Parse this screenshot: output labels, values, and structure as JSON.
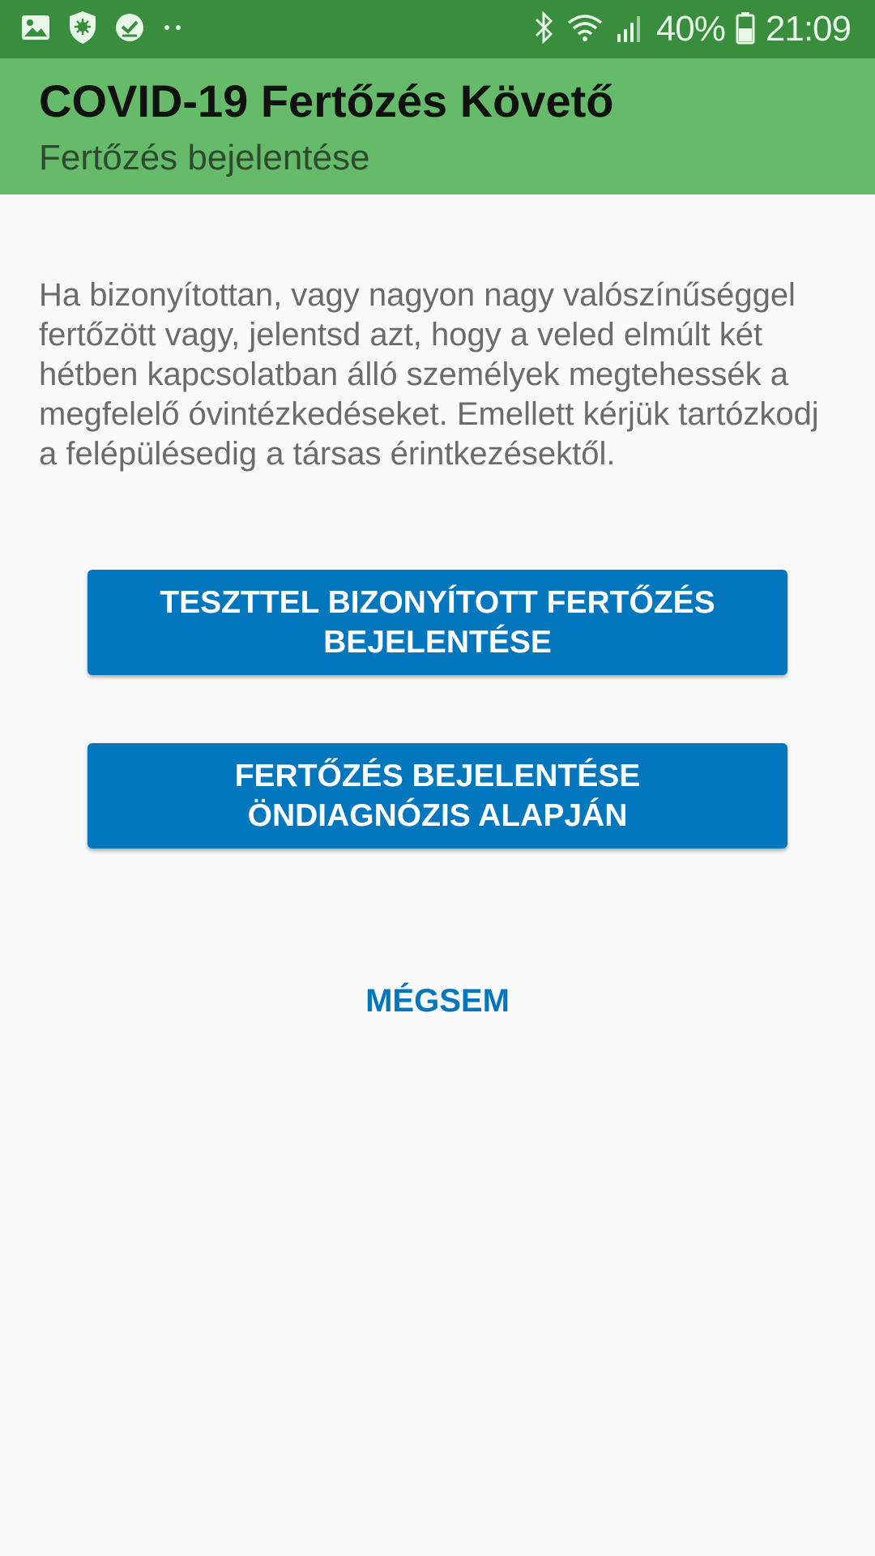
{
  "status_bar": {
    "battery_percent": "40%",
    "time": "21:09",
    "icons": [
      "gallery-icon",
      "shield-virus-icon",
      "check-circle-icon",
      "more-dots-icon",
      "bluetooth-icon",
      "wifi-icon",
      "signal-icon",
      "battery-icon"
    ]
  },
  "app_bar": {
    "title": "COVID-19 Fertőzés Követő",
    "subtitle": "Fertőzés bejelentése"
  },
  "content": {
    "intro": "Ha bizonyítottan, vagy nagyon nagy valószínűséggel fertőzött vagy, jelentsd azt, hogy a veled elmúlt két hétben kapcsolatban álló személyek megtehessék a megfelelő óvintézkedéseket. Emellett kérjük tartózkodj a felépülésedig a társas érintkezésektől.",
    "test_confirmed_button": "TESZTTEL BIZONYÍTOTT FERTŐZÉS BEJELENTÉSE",
    "self_diagnosis_button": "FERTŐZÉS BEJELENTÉSE ÖNDIAGNÓZIS ALAPJÁN",
    "cancel_button": "MÉGSEM"
  },
  "colors": {
    "status_bar": "#388e3c",
    "app_bar": "#66bb6a",
    "accent": "#0277bd"
  }
}
